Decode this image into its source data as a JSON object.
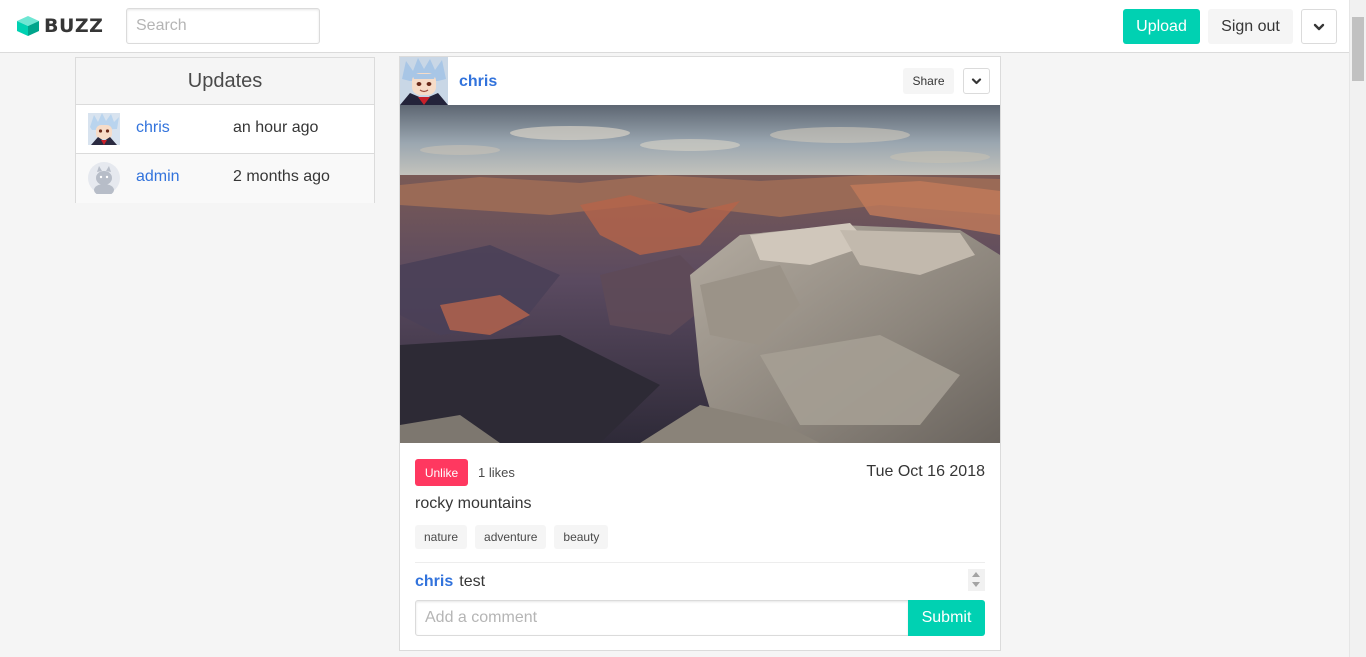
{
  "navbar": {
    "brand": "BUZZ",
    "brand_icon": "cube-logo-icon",
    "search_placeholder": "Search",
    "upload_label": "Upload",
    "signout_label": "Sign out",
    "menu_icon": "chevron-down-icon"
  },
  "updates": {
    "title": "Updates",
    "items": [
      {
        "name": "chris",
        "time": "an hour ago",
        "avatar": "anime-avatar"
      },
      {
        "name": "admin",
        "time": "2 months ago",
        "avatar": "default-avatar"
      }
    ]
  },
  "post": {
    "user": "chris",
    "share_label": "Share",
    "image": "canyon-landscape-photo",
    "unlike_label": "Unlike",
    "likes": "1 likes",
    "date": "Tue Oct 16 2018",
    "caption": "rocky mountains",
    "tags": [
      "nature",
      "adventure",
      "beauty"
    ],
    "comments": [
      {
        "user": "chris",
        "text": "test"
      }
    ],
    "comment_placeholder": "Add a comment",
    "submit_label": "Submit"
  },
  "colors": {
    "primary": "#00d1b2",
    "link": "#3273dc",
    "danger": "#ff3860"
  }
}
